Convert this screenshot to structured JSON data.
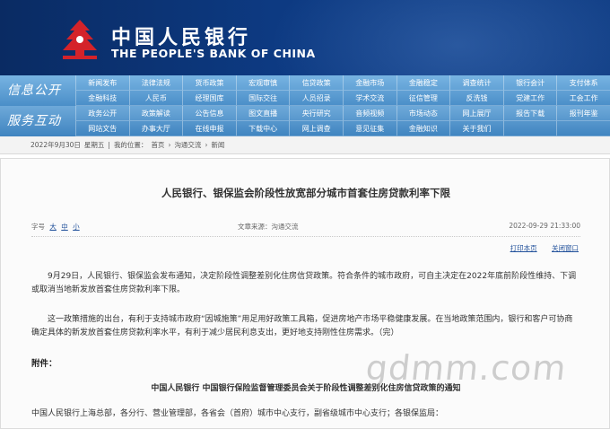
{
  "header": {
    "title_cn": "中国人民银行",
    "title_en": "THE PEOPLE'S BANK OF CHINA",
    "brand_color": "#0d3a82",
    "logo_color": "#d4232a"
  },
  "nav": {
    "groups": [
      {
        "label": "信息公开",
        "items": [
          "新闻发布",
          "法律法规",
          "货币政策",
          "宏观审慎",
          "信贷政策",
          "金融市场",
          "金融稳定",
          "调查统计",
          "银行会计",
          "支付体系",
          "金融科技",
          "人民币",
          "经理国库",
          "国际交往",
          "人员招录",
          "学术交流",
          "征信管理",
          "反洗钱",
          "党建工作",
          "工会工作"
        ]
      },
      {
        "label": "服务互动",
        "items": [
          "政务公开",
          "政策解读",
          "公告信息",
          "图文直播",
          "央行研究",
          "音频视频",
          "市场动态",
          "网上展厅",
          "报告下载",
          "报刊年鉴",
          "网站文告",
          "办事大厅",
          "在线申报",
          "下载中心",
          "网上调查",
          "意见征集",
          "金融知识",
          "关于我们",
          "",
          ""
        ]
      }
    ]
  },
  "breadcrumb": {
    "date": "2022年9月30日",
    "weekday": "星期五",
    "location_label": "我的位置：",
    "items": [
      "首页",
      "沟通交流",
      "新闻"
    ],
    "separator": "›"
  },
  "article": {
    "title": "人民银行、银保监会阶段性放宽部分城市首套住房贷款利率下限",
    "font_size_label": "字号",
    "font_sizes": [
      "大",
      "中",
      "小"
    ],
    "source": "文章来源：沟通交流",
    "datetime": "2022-09-29 21:33:00",
    "print_label": "打印本页",
    "close_label": "关闭窗口",
    "paragraph1": "9月29日，人民银行、银保监会发布通知，决定阶段性调整差别化住房信贷政策。符合条件的城市政府，可自主决定在2022年底前阶段性维持、下调或取消当地新发放首套住房贷款利率下限。",
    "paragraph2": "这一政策措施的出台，有利于支持城市政府“因城施策”用足用好政策工具箱，促进房地产市场平稳健康发展。在当地政策范围内，银行和客户可协商确定具体的新发放首套住房贷款利率水平，有利于减少居民利息支出，更好地支持刚性住房需求。（完）",
    "attachment_label": "附件：",
    "notice_title": "中国人民银行 中国银行保险监督管理委员会关于阶段性调整差别化住房信贷政策的通知",
    "addressee": "中国人民银行上海总部，各分行、营业管理部，各省会（首府）城市中心支行，副省级城市中心支行；各银保监局："
  },
  "watermark": "gdmm.com"
}
